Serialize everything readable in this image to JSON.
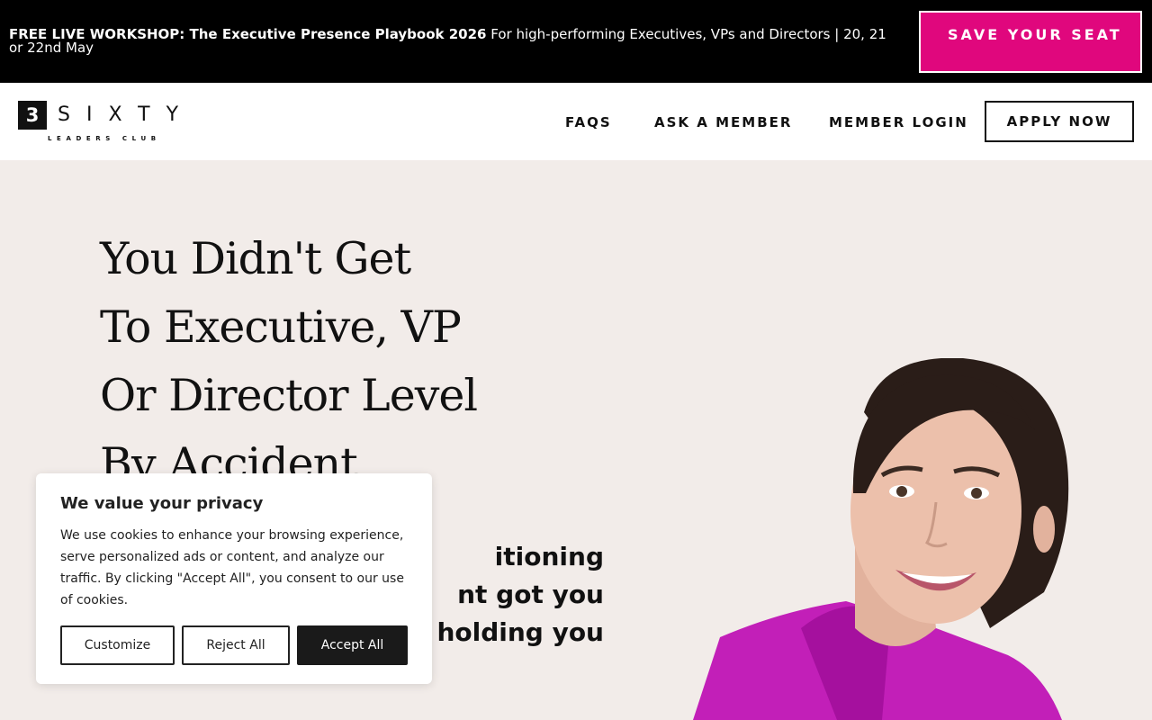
{
  "topbar": {
    "announcement_bold": "FREE LIVE WORKSHOP: The Executive Presence Playbook 2026",
    "announcement_rest": " For high-performing Executives, VPs and Directors | 20, 21 or 22nd May",
    "cta_label": "SAVE YOUR SEAT",
    "cta_color": "#e0077d"
  },
  "header": {
    "logo": {
      "number": "3",
      "word": "SIXTY",
      "sub": "LEADERS CLUB"
    },
    "nav": [
      "FAQS",
      "ASK A MEMBER",
      "MEMBER LOGIN"
    ],
    "apply_label": "APPLY NOW"
  },
  "hero": {
    "headline": [
      "You Didn't Get",
      "To Executive, VP",
      "Or Director Level",
      "By Accident."
    ],
    "subline": [
      "itioning",
      "nt got you",
      "holding you"
    ],
    "background": "#f2ece9"
  },
  "cookie": {
    "title": "We value your privacy",
    "text": "We use cookies to enhance your browsing experience, serve personalized ads or content, and analyze our traffic. By clicking \"Accept All\", you consent to our use of cookies.",
    "customize_label": "Customize",
    "reject_label": "Reject All",
    "accept_label": "Accept All"
  }
}
